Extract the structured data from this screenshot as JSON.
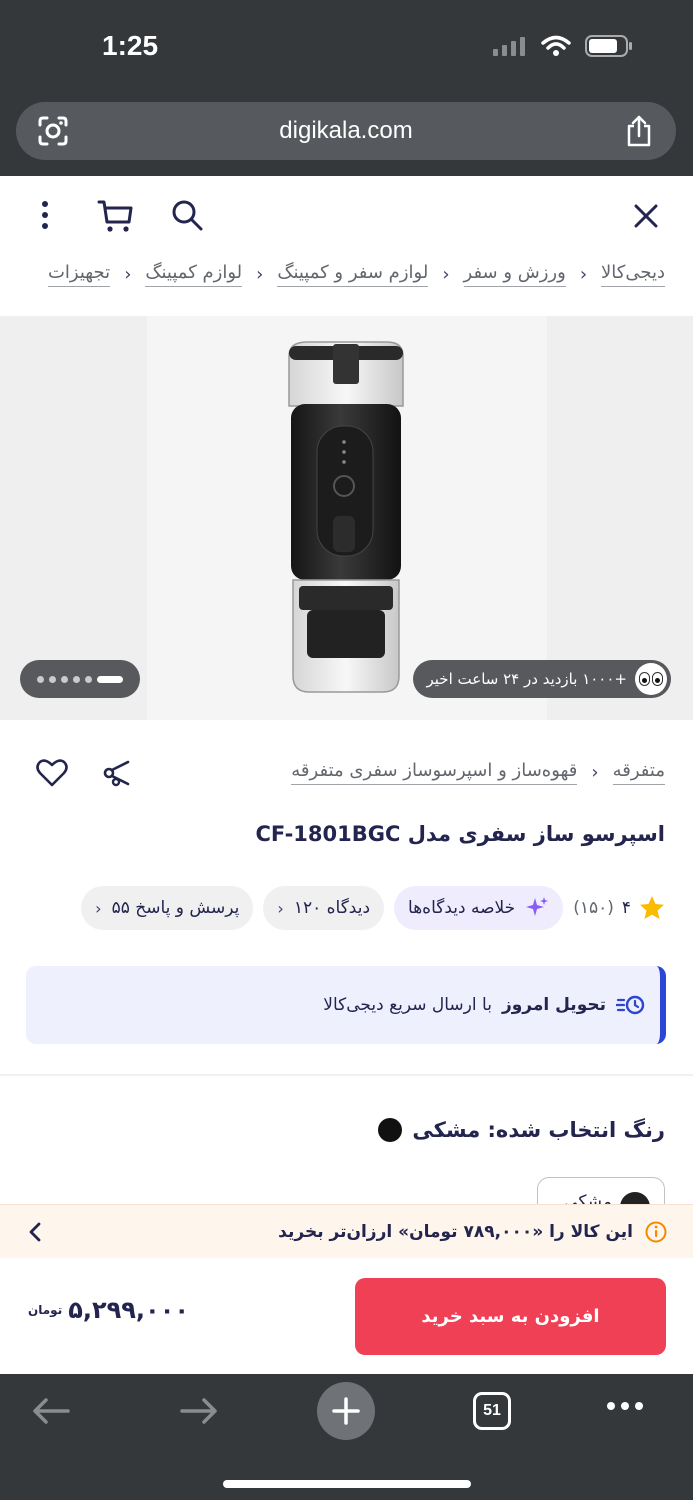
{
  "status_bar": {
    "time": "1:25"
  },
  "browser": {
    "url": "digikala.com",
    "tab_count": "51"
  },
  "breadcrumb": [
    "دیجی‌کالا",
    "ورزش و سفر",
    "لوازم سفر و کمپینگ",
    "لوازم کمپینگ",
    "تجهیزات"
  ],
  "gallery": {
    "views_text": "+۱۰۰۰ بازدید در ۲۴ ساعت اخیر",
    "dots": 6,
    "active_dot": 0
  },
  "product": {
    "category_crumb": [
      "متفرقه",
      "قهوه‌ساز و اسپرسوساز سفری متفرقه"
    ],
    "title": "اسپرسو ساز سفری مدل CF-1801BGC",
    "rating": "۴",
    "rating_count": "(۱۵۰)",
    "summary_chip": "خلاصه دیدگاه‌ها",
    "reviews_chip": "۱۲۰ دیدگاه",
    "qa_chip": "۵۵ پرسش و پاسخ",
    "delivery_bold": "تحویل امروز",
    "delivery_rest": "با ارسال سریع دیجی‌کالا",
    "color_label": "رنگ انتخاب شده: مشکی",
    "swatch_label": "مشکی"
  },
  "cheaper_banner": {
    "text": "این کالا را «۷۸۹,۰۰۰ تومان» ارزان‌تر بخرید"
  },
  "buy": {
    "button": "افزودن به سبد خرید",
    "price": "۵,۲۹۹,۰۰۰",
    "currency": "تومان"
  },
  "colors": {
    "primary": "#ef4056",
    "delivery_accent": "#2b46d4",
    "dark_chrome": "#35383b"
  }
}
